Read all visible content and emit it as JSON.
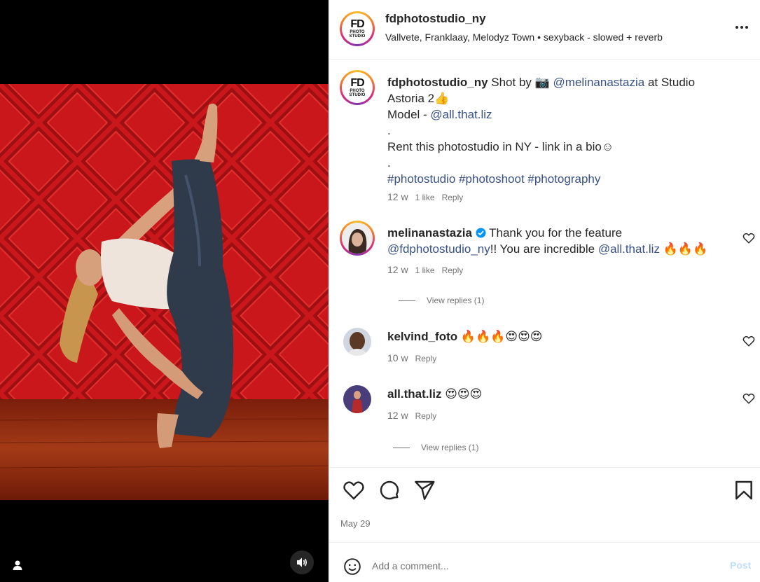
{
  "post": {
    "username": "fdphotostudio_ny",
    "audio": "Vallvete, Franklaay, Melodyz Town • sexyback - slowed + reverb",
    "logo_text": {
      "big": "FD",
      "small": "PHOTO STUDIO"
    },
    "caption": {
      "username": "fdphotostudio_ny",
      "line1_pre": "Shot by 📷",
      "mention1": "@melinanastazia",
      "line1_post": "at Studio Astoria 2👍",
      "model_label": "Model -",
      "mention2": "@all.that.liz",
      "dot1": ".",
      "rent": "Rent this photostudio in NY - link in a bio☺",
      "dot2": ".",
      "hashtags": "#photostudio #photoshoot #photography",
      "time": "12 w",
      "likes": "1 like",
      "reply": "Reply"
    },
    "date": "May 29"
  },
  "comments": [
    {
      "username": "melinanastazia",
      "verified": true,
      "text_pre": "Thank you for the feature",
      "mention": "@fdphotostudio_ny",
      "text_mid": "!! You are incredible",
      "mention2": "@all.that.liz",
      "emojis": "🔥🔥🔥",
      "time": "12 w",
      "likes": "1 like",
      "reply": "Reply",
      "view_replies": "View replies (1)"
    },
    {
      "username": "kelvind_foto",
      "text": "🔥🔥🔥😍😍😍",
      "time": "10 w",
      "reply": "Reply"
    },
    {
      "username": "all.that.liz",
      "text": "😍😍😍",
      "time": "12 w",
      "reply": "Reply",
      "view_replies": "View replies (1)"
    }
  ],
  "composer": {
    "placeholder": "Add a comment...",
    "post_label": "Post"
  },
  "colors": {
    "link": "#385185",
    "muted": "#737373",
    "post_disabled": "#c0dffd",
    "wall_red": "#c8161b",
    "floor": "#8a2a10"
  }
}
